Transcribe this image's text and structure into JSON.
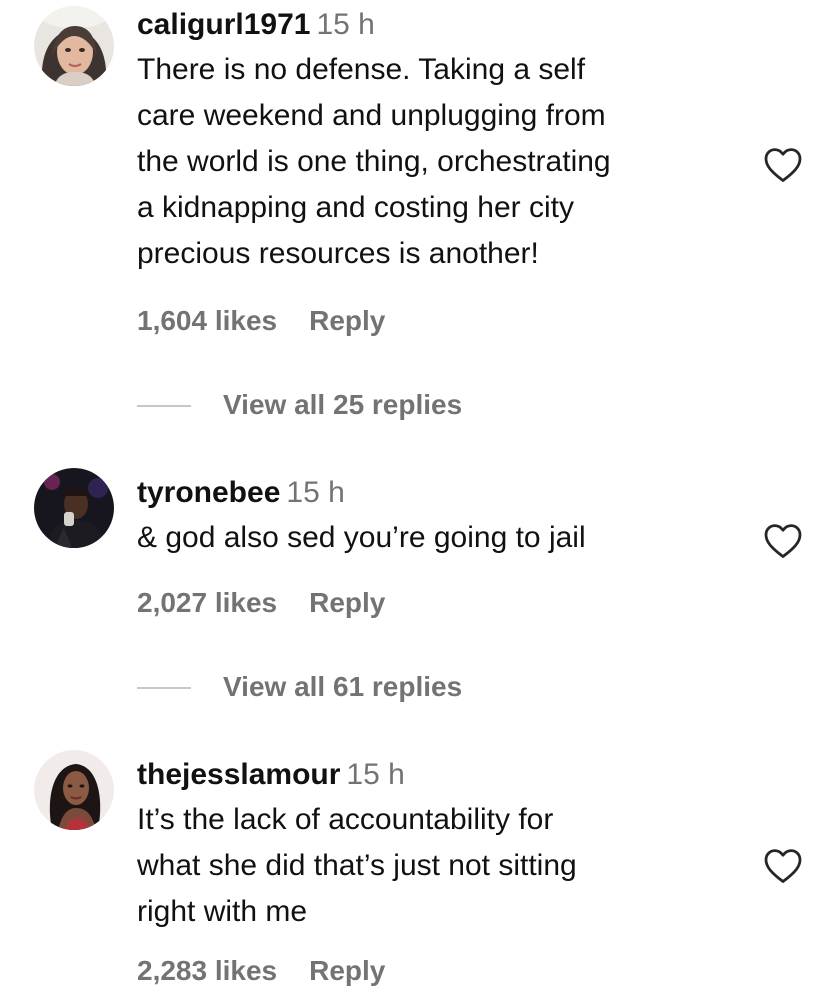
{
  "comments": [
    {
      "username": "caligurl1971",
      "time": "15 h",
      "text_lines": [
        "There is no defense. Taking a self",
        "care weekend and unplugging from",
        "the world is one thing, orchestrating",
        "a kidnapping and costing her city",
        "precious resources is another!"
      ],
      "likes": "1,604 likes",
      "reply_label": "Reply",
      "view_replies": "View all 25 replies",
      "avatar_icon": "user-avatar-photo",
      "like_icon": "heart-outline-icon"
    },
    {
      "username": "tyronebee",
      "time": "15 h",
      "text_lines": [
        "& god also sed you’re going to jail"
      ],
      "likes": "2,027 likes",
      "reply_label": "Reply",
      "view_replies": "View all 61 replies",
      "avatar_icon": "user-avatar-photo",
      "like_icon": "heart-outline-icon"
    },
    {
      "username": "thejesslamour",
      "time": "15 h",
      "text_lines": [
        "It’s the lack of accountability for",
        "what she did that’s just not sitting",
        "right with me"
      ],
      "likes": "2,283 likes",
      "reply_label": "Reply",
      "avatar_icon": "user-avatar-photo",
      "like_icon": "heart-outline-icon"
    }
  ],
  "colors": {
    "text": "#111111",
    "secondary": "#737373",
    "divider": "#c7c7c7"
  }
}
